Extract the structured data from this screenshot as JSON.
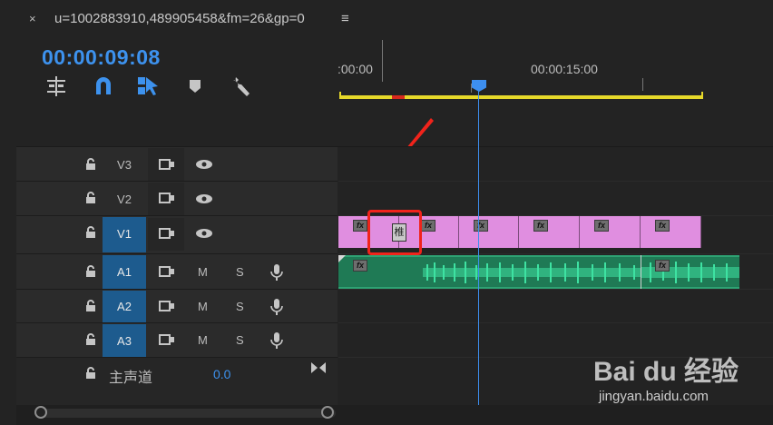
{
  "tab": {
    "close_glyph": "×",
    "title": "u=1002883910,489905458&fm=26&gp=0",
    "menu_glyph": "≡"
  },
  "timecode": "00:00:09:08",
  "tools": [
    {
      "icon": "insert-sequence-icon"
    },
    {
      "icon": "snap-magnet-icon"
    },
    {
      "icon": "linked-selection-icon"
    },
    {
      "icon": "add-marker-icon"
    },
    {
      "icon": "wrench-settings-icon"
    }
  ],
  "ruler": {
    "start_label": ":00:00",
    "mid_label": "00:00:15:00"
  },
  "tracks": {
    "v3": {
      "name": "V3"
    },
    "v2": {
      "name": "V2"
    },
    "v1": {
      "name": "V1"
    },
    "a1": {
      "name": "A1",
      "mute": "M",
      "solo": "S"
    },
    "a2": {
      "name": "A2",
      "mute": "M",
      "solo": "S"
    },
    "a3": {
      "name": "A3",
      "mute": "M",
      "solo": "S"
    },
    "master": {
      "name": "主声道",
      "value": "0.0"
    }
  },
  "clips": {
    "fx_label": "fx",
    "cursor_glyph": "椎"
  },
  "watermark": {
    "brand": "Bai du 经验",
    "url": "jingyan.baidu.com"
  },
  "colors": {
    "accent_blue": "#3d92ee",
    "video_clip": "#e08ee0",
    "audio_clip": "#1f7a55",
    "work_area": "#e6d82a",
    "highlight_red": "#f0231b"
  }
}
